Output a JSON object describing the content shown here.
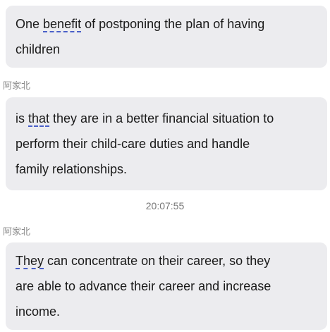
{
  "messages": [
    {
      "sender": "",
      "line1_pre": "One ",
      "line1_mark": "benefit",
      "line1_post": " of postponing the plan of having",
      "line2": "children"
    },
    {
      "sender": "阿家北",
      "line1_pre": " is ",
      "line1_mark": "that",
      "line1_post": " they are in a better financial situation to",
      "line2": "perform their child-care duties and handle",
      "line3": "family relationships."
    },
    {
      "sender": "阿家北",
      "line1_mark": "They",
      "line1_post": " can concentrate on their career, so they",
      "line2": "are able to advance their career and increase",
      "line3": "income."
    }
  ],
  "timestamp": "20:07:55",
  "colors": {
    "bubble": "#ececef",
    "text": "#1a1a1a",
    "underline": "#4a60c8",
    "meta": "#8a8a8a"
  }
}
